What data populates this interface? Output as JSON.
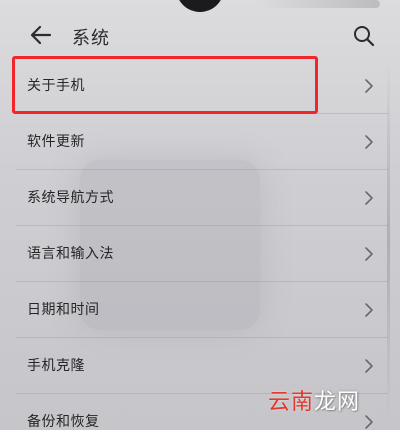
{
  "header": {
    "title": "系统",
    "back_icon": "arrow-left-icon",
    "search_icon": "search-icon"
  },
  "list": {
    "items": [
      {
        "label": "关于手机",
        "highlighted": true
      },
      {
        "label": "软件更新"
      },
      {
        "label": "系统导航方式"
      },
      {
        "label": "语言和输入法"
      },
      {
        "label": "日期和时间"
      },
      {
        "label": "手机克隆"
      },
      {
        "label": "备份和恢复"
      }
    ]
  },
  "watermark": {
    "red_part": "云南",
    "white_part": "龙网"
  },
  "colors": {
    "highlight": "#f1262a",
    "background": "#d2d1d5",
    "text": "#262628"
  }
}
